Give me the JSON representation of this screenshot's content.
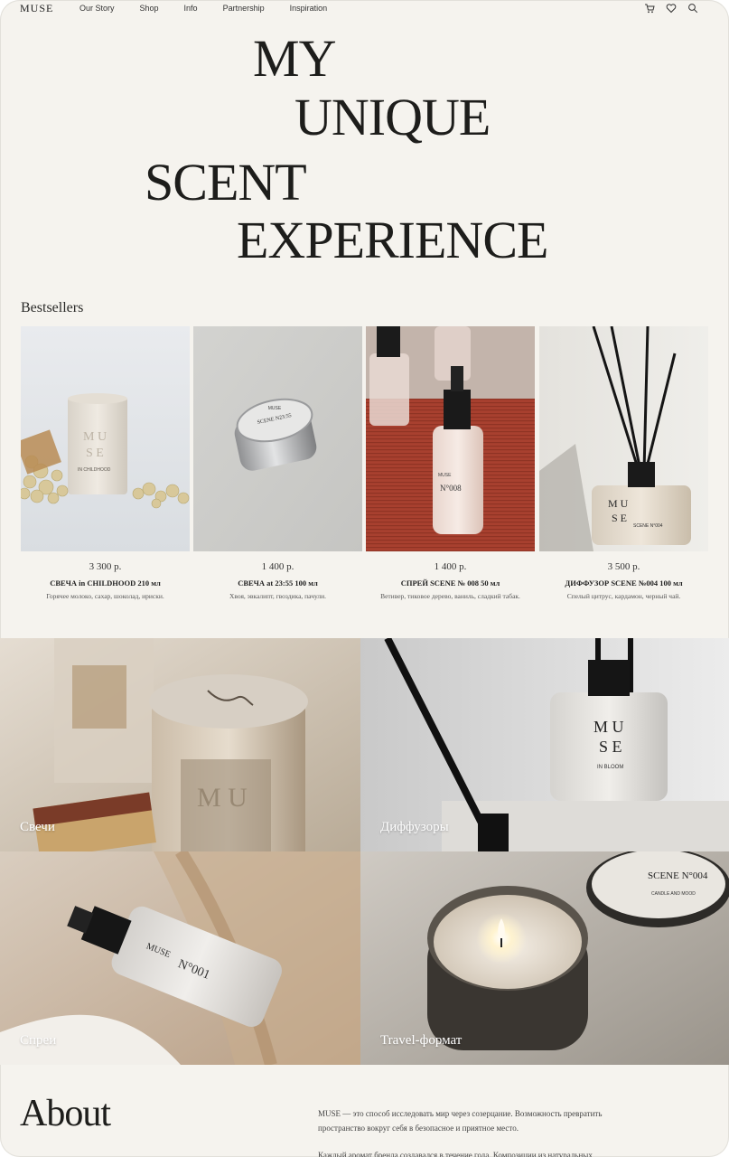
{
  "header": {
    "logo": "MUSE",
    "nav": [
      "Our Story",
      "Shop",
      "Info",
      "Partnership",
      "Inspiration"
    ]
  },
  "hero": {
    "line1": "MY",
    "line2": "UNIQUE",
    "line3": "SCENT",
    "line4": "EXPERIENCE"
  },
  "bestsellers": {
    "title": "Bestsellers",
    "items": [
      {
        "price": "3 300 р.",
        "name": "СВЕЧА in CHILDHOOD 210 мл",
        "desc": "Горячее молоко, сахар, шоколад, ириски.",
        "label": "IN CHILDHOOD"
      },
      {
        "price": "1 400 р.",
        "name": "СВЕЧА at 23:55 100 мл",
        "desc": "Хвоя, эвкалипт, гвоздика, пачули.",
        "label": "SCENE N23:55"
      },
      {
        "price": "1 400 р.",
        "name": "СПРЕЙ SCENE № 008 50 мл",
        "desc": "Ветивер, тиковое дерево, ваниль, сладкий табак.",
        "label": "N°008"
      },
      {
        "price": "3 500 р.",
        "name": "ДИФФУЗОР SCENE №004 100 мл",
        "desc": "Спелый цитрус, кардамон, черный чай.",
        "label": "SCENE N°004"
      }
    ]
  },
  "categories": [
    {
      "label": "Свечи"
    },
    {
      "label": "Диффузоры"
    },
    {
      "label": "Спреи"
    },
    {
      "label": "Travel-формат"
    }
  ],
  "photo_text": {
    "muse": "MUSE",
    "muse_stack_1": "M U",
    "muse_stack_2": "S E",
    "in_bloom": "IN BLOOM",
    "scene_004": "SCENE N°004",
    "candle_mood": "CANDLE AND MOOD",
    "n001": "N°001"
  },
  "about": {
    "title": "About",
    "p1": "MUSE — это способ исследовать мир через созерцание. Возможность превратить пространство вокруг себя в безопасное и приятное место.",
    "p2": "Каждый аромат бренда создавался в течение года. Композиции из натуральных"
  },
  "colors": {
    "background": "#f5f3ee",
    "text": "#1d1d1b",
    "spray_backdrop": "#a8402f"
  }
}
